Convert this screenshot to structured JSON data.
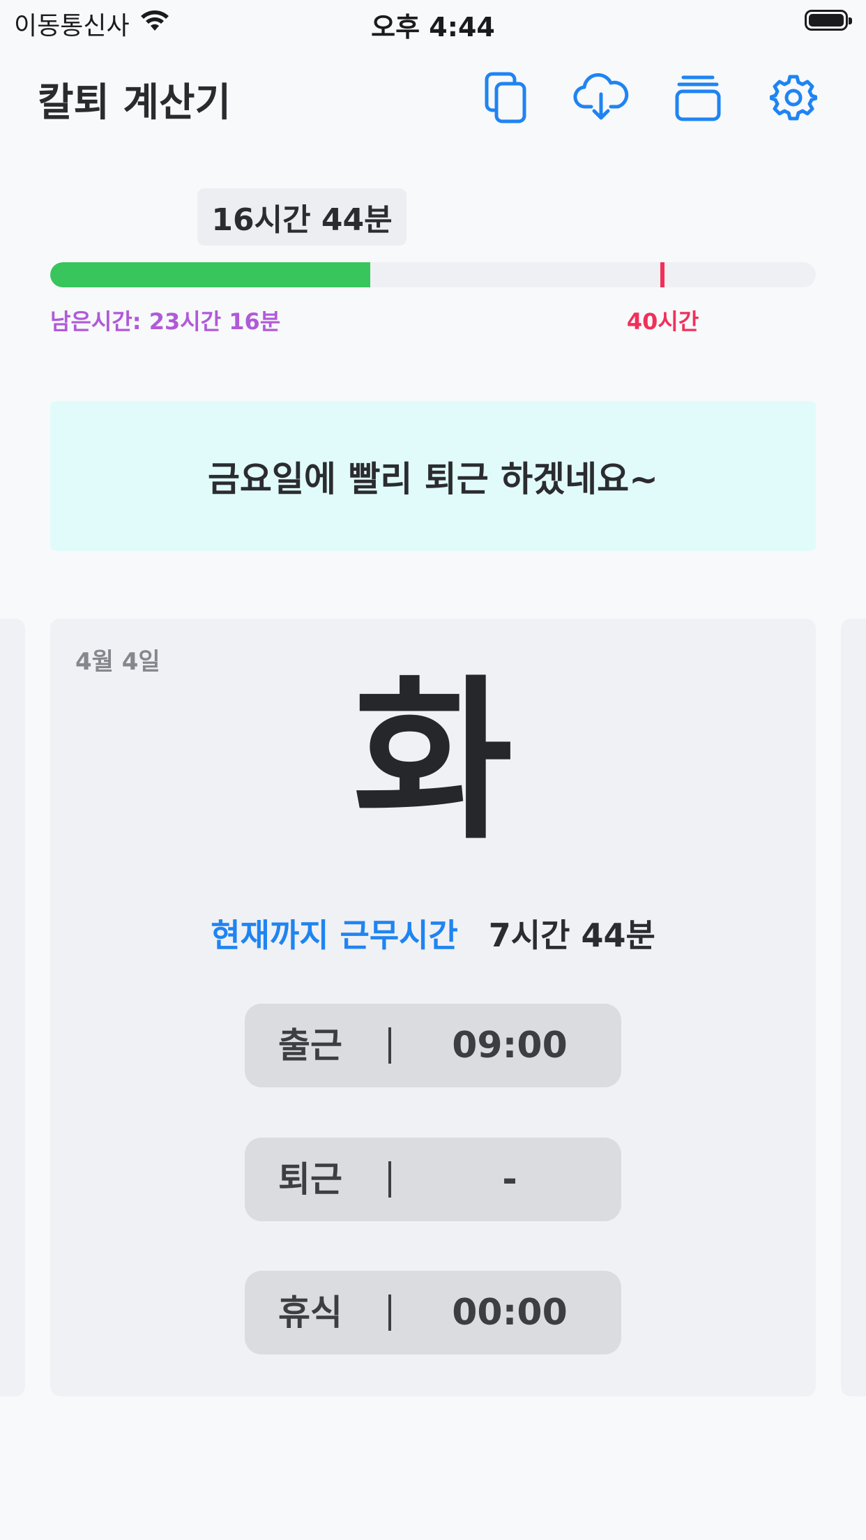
{
  "status_bar": {
    "carrier": "이동통신사",
    "time": "오후 4:44"
  },
  "header": {
    "title": "칼퇴 계산기",
    "icons": [
      "copy-icon",
      "cloud-download-icon",
      "stack-icon",
      "gear-icon"
    ],
    "accent_color": "#1f84f2"
  },
  "progress": {
    "total_worked": "16시간 44분",
    "fraction_filled": 0.418,
    "goal_fraction": 0.8,
    "remaining": "남은시간: 23시간 16분",
    "goal_label": "40시간",
    "fill_color": "#37c55c",
    "goal_color": "#f0305a",
    "remaining_color": "#b05ad8"
  },
  "banner": {
    "message": "금요일에 빨리 퇴근 하겠네요~",
    "background": "#e1fbfb"
  },
  "day_card": {
    "date": "4월 4일",
    "weekday": "화",
    "worked_label": "현재까지 근무시간",
    "worked_value": "7시간 44분",
    "rows": [
      {
        "label": "출근",
        "value": "09:00"
      },
      {
        "label": "퇴근",
        "value": "-"
      },
      {
        "label": "휴식",
        "value": "00:00"
      }
    ]
  }
}
